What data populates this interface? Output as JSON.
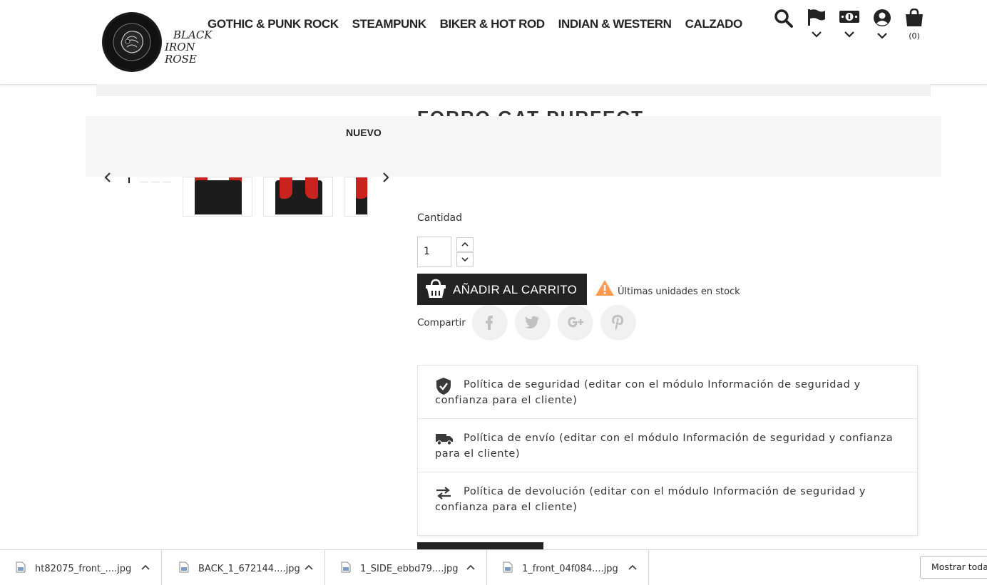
{
  "logo": {
    "line1": "BLACK",
    "line2": "IRON ROSE"
  },
  "nav": [
    "GOTHIC & PUNK ROCK",
    "STEAMPUNK",
    "BIKER & HOT ROD",
    "INDIAN & WESTERN",
    "CALZADO"
  ],
  "header": {
    "cart_count": "(0)"
  },
  "product": {
    "title": "FORRO GAT PURFECT",
    "badge": "NUEVO",
    "quantity_label": "Cantidad",
    "quantity_value": "1",
    "add_to_cart": "AÑADIR AL CARRITO",
    "stock_notice": "Últimas unidades en stock",
    "share_label": "Compartir"
  },
  "reassurance": [
    {
      "icon": "verified-shield-icon",
      "text": "Política de seguridad (editar con el módulo Información de seguridad y confianza para el cliente)"
    },
    {
      "icon": "delivery-truck-icon",
      "text": "Política de envío (editar con el módulo Información de seguridad y confianza para el cliente)"
    },
    {
      "icon": "swap-arrows-icon",
      "text": "Política de devolución (editar con el módulo Información de seguridad y confianza para el cliente)"
    }
  ],
  "downloads": {
    "items": [
      "ht82075_front_....jpg",
      "BACK_1_672144....jpg",
      "1_SIDE_ebbd79....jpg",
      "1_front_04f084....jpg"
    ],
    "show_all": "Mostrar todas"
  },
  "colors": {
    "dark": "#232323",
    "accent_red": "#c8231f",
    "warning": "#ff9a52"
  }
}
